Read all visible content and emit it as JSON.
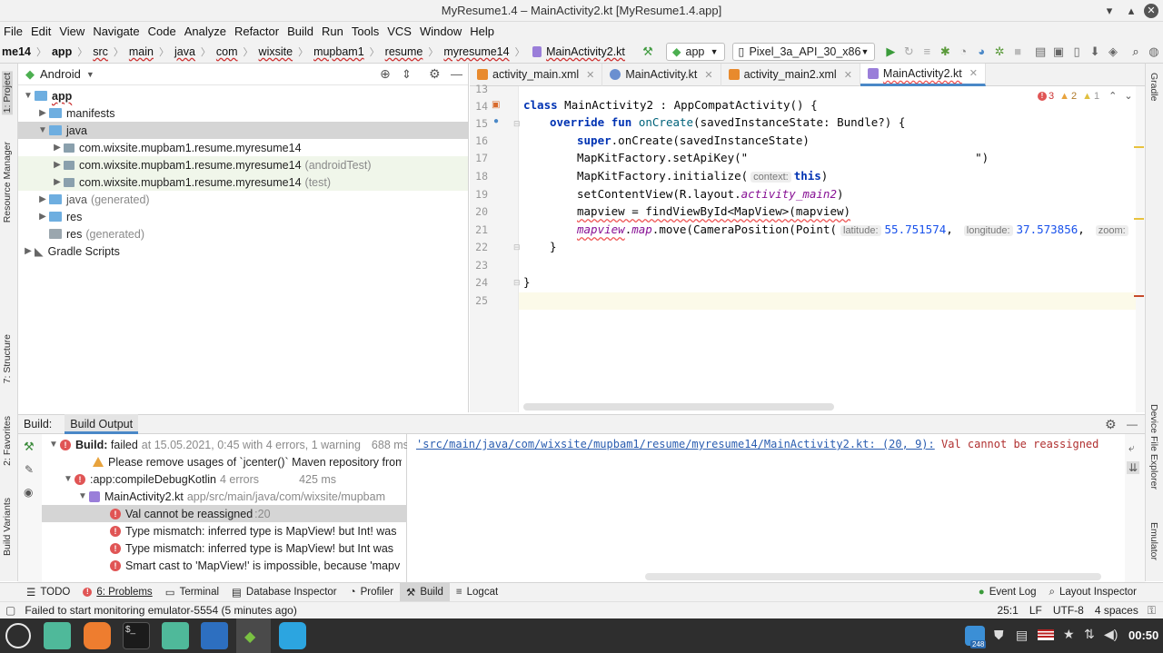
{
  "window": {
    "title": "MyResume1.4 – MainActivity2.kt [MyResume1.4.app]"
  },
  "menu": [
    "File",
    "Edit",
    "View",
    "Navigate",
    "Code",
    "Analyze",
    "Refactor",
    "Build",
    "Run",
    "Tools",
    "VCS",
    "Window",
    "Help"
  ],
  "breadcrumbs": [
    "me14",
    "app",
    "src",
    "main",
    "java",
    "com",
    "wixsite",
    "mupbam1",
    "resume",
    "myresume14",
    "MainActivity2.kt"
  ],
  "toolbar": {
    "run_config": "app",
    "device": "Pixel_3a_API_30_x86"
  },
  "left_stripe": [
    "1: Project",
    "Resource Manager",
    "7: Structure",
    "2: Favorites",
    "Build Variants"
  ],
  "right_stripe": [
    "Gradle",
    "Device File Explorer",
    "Emulator"
  ],
  "project": {
    "view": "Android",
    "tree": [
      {
        "label": "app",
        "extra": ""
      },
      {
        "label": "manifests",
        "extra": ""
      },
      {
        "label": "java",
        "extra": ""
      },
      {
        "label": "com.wixsite.mupbam1.resume.myresume14",
        "extra": ""
      },
      {
        "label": "com.wixsite.mupbam1.resume.myresume14",
        "extra": "(androidTest)"
      },
      {
        "label": "com.wixsite.mupbam1.resume.myresume14",
        "extra": "(test)"
      },
      {
        "label": "java",
        "extra": "(generated)"
      },
      {
        "label": "res",
        "extra": ""
      },
      {
        "label": "res",
        "extra": "(generated)"
      },
      {
        "label": "Gradle Scripts",
        "extra": ""
      }
    ]
  },
  "tabs": [
    {
      "label": "activity_main.xml"
    },
    {
      "label": "MainActivity.kt"
    },
    {
      "label": "activity_main2.xml"
    },
    {
      "label": "MainActivity2.kt"
    }
  ],
  "inspections": {
    "errors": "3",
    "warnings": "2",
    "weak": "1"
  },
  "code": {
    "lines": [
      "13",
      "14",
      "15",
      "16",
      "17",
      "18",
      "19",
      "20",
      "21",
      "22",
      "23",
      "24",
      "25"
    ],
    "l14_kw": "class",
    "l14_rest": " MainActivity2 : AppCompatActivity() {",
    "l15_kw": "override fun",
    "l15_fn": " onCreate",
    "l15_rest": "(savedInstanceState: Bundle?) {",
    "l16_kw": "super",
    "l16_rest": ".onCreate(savedInstanceState)",
    "l17": "MapKitFactory.setApiKey(\"",
    "l17_end": "\")",
    "l18": "MapKitFactory.initialize(",
    "l18_hint": "context:",
    "l18_kw": "this",
    "l18_end": ")",
    "l19": "setContentView(R.layout.",
    "l19_it": "activity_main2",
    "l19_end": ")",
    "l20": "mapview = findViewById<MapView>(mapview)",
    "l21_a": "mapview",
    "l21_b": ".",
    "l21_c": "map",
    "l21_d": ".move(CameraPosition(Point(",
    "l21_hint1": "latitude:",
    "l21_lat": "55.751574",
    "l21_comma": ",",
    "l21_hint2": "longitude:",
    "l21_lon": "37.573856",
    "l21_hint3": "zoom:",
    "l22": "}",
    "l24": "}"
  },
  "build": {
    "header_label": "Build:",
    "tab": "Build Output",
    "rows": [
      {
        "title": "Build:",
        "text": "failed",
        "extra": "at 15.05.2021, 0:45 with 4 errors, 1 warning",
        "time": "688 ms"
      },
      {
        "text": "Please remove usages of `jcenter()` Maven repository from y"
      },
      {
        "text": ":app:compileDebugKotlin",
        "extra": "4 errors",
        "time": "425 ms"
      },
      {
        "text": "MainActivity2.kt",
        "extra": "app/src/main/java/com/wixsite/mupbam"
      },
      {
        "text": "Val cannot be reassigned",
        "extra": ":20"
      },
      {
        "text": "Type mismatch: inferred type is MapView! but Int! was"
      },
      {
        "text": "Type mismatch: inferred type is MapView! but Int was "
      },
      {
        "text": "Smart cast to 'MapView!' is impossible, because 'mapv"
      }
    ],
    "output_path": "'src/main/java/com/wixsite/mupbam1/resume/myresume14/MainActivity2.kt: (20, 9):",
    "output_msg": " Val cannot be reassigned"
  },
  "bottom_tools": [
    {
      "label": "TODO"
    },
    {
      "label": "6: Problems"
    },
    {
      "label": "Terminal"
    },
    {
      "label": "Database Inspector"
    },
    {
      "label": "Profiler"
    },
    {
      "label": "Build"
    },
    {
      "label": "Logcat"
    }
  ],
  "bottom_right_tools": [
    {
      "label": "Event Log"
    },
    {
      "label": "Layout Inspector"
    }
  ],
  "status": {
    "message": "Failed to start monitoring emulator-5554 (5 minutes ago)",
    "position": "25:1",
    "line_sep": "LF",
    "encoding": "UTF-8",
    "indent": "4 spaces"
  },
  "taskbar": {
    "clock": "00:50",
    "badge": "248"
  }
}
